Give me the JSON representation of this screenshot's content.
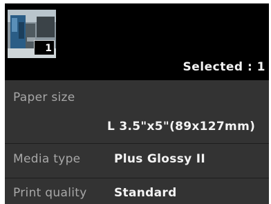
{
  "thumbnail": {
    "count": "1",
    "icon": "photo-thumbnail-icon"
  },
  "selection": {
    "label": "Selected : 1"
  },
  "settings": [
    {
      "label": "Paper size",
      "value": "L 3.5\"x5\"(89x127mm)"
    },
    {
      "label": "Media type",
      "value": "Plus Glossy II"
    },
    {
      "label": "Print quality",
      "value": "Standard"
    }
  ],
  "colors": {
    "screen_background": "#000000",
    "settings_background": "#333333",
    "label_text": "#a8a8a8",
    "value_text": "#f4f4f4"
  }
}
